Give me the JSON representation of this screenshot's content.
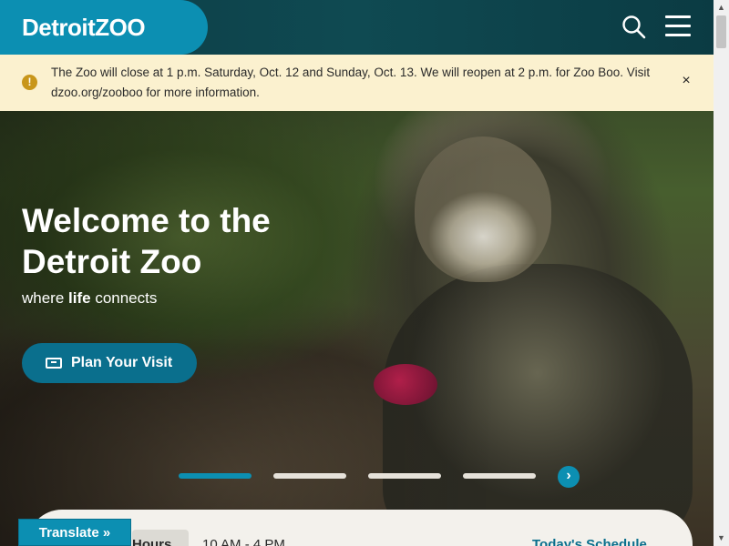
{
  "header": {
    "logo_text": "DetroitZOO",
    "search_icon": "search-icon",
    "menu_icon": "hamburger-menu-icon"
  },
  "alert": {
    "icon": "warning-icon",
    "message": "The Zoo will close at 1 p.m. Saturday, Oct. 12 and Sunday, Oct. 13. We will reopen at 2 p.m. for Zoo Boo. Visit dzoo.org/zooboo for more information.",
    "close_label": "×"
  },
  "hero": {
    "title": "Welcome to the Detroit Zoo",
    "tagline_pre": "where ",
    "tagline_bold": "life",
    "tagline_post": " connects",
    "cta_label": "Plan Your Visit",
    "cta_icon": "ticket-icon"
  },
  "carousel": {
    "slide_count": 4,
    "active_index": 0,
    "next_label": "›"
  },
  "hours": {
    "label": "Hours",
    "time": "10 AM - 4 PM",
    "schedule_link": "Today's Schedule"
  },
  "translate": {
    "label": "Translate »"
  },
  "colors": {
    "brand_blue": "#0c8fb2",
    "header_dark": "#0d3b44",
    "alert_bg": "#fbf1cf",
    "cta_bg": "#0a6f8d"
  }
}
